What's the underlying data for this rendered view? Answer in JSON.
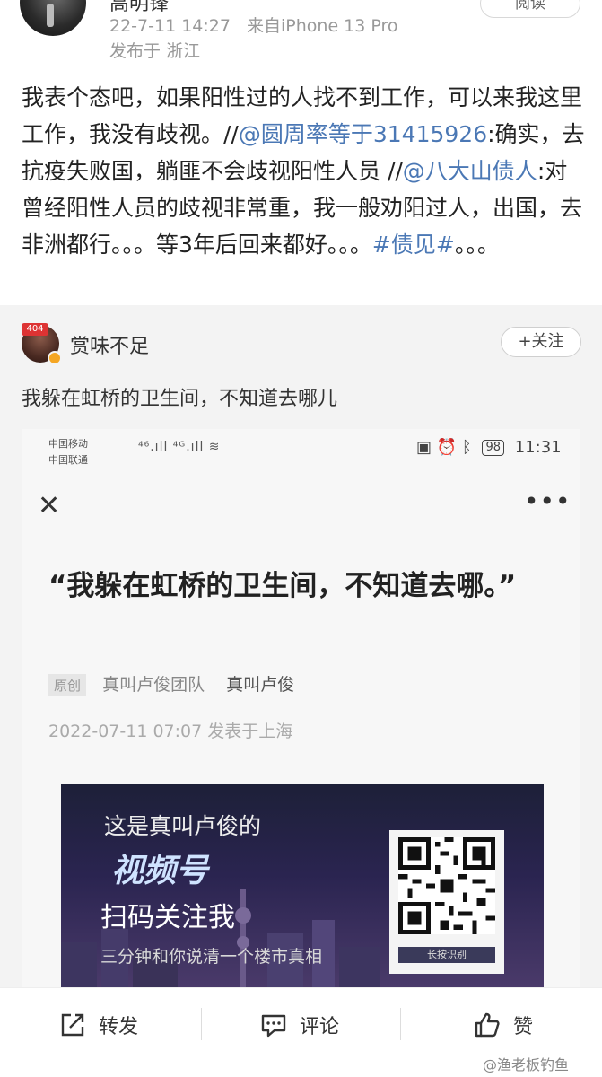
{
  "post": {
    "author_name": "高明锋",
    "timestamp": "22-7-11 14:27",
    "source": "来自iPhone 13 Pro",
    "location": "发布于 浙江",
    "read_button": "阅读",
    "text_part1": "我表个态吧，如果阳性过的人找不到工作，可以来我这里工作，我没有歧视。//",
    "mention1": "@圆周率等于31415926",
    "text_part2": ":确实，去抗疫失败国，躺匪不会歧视阳性人员 //",
    "mention2": "@八大山债人",
    "text_part3": ":对曾经阳性人员的歧视非常重，我一般劝阳过人，出国，去非洲都行。。。等3年后回来都好。。。",
    "hashtag": "#债见#",
    "text_part4": "。。。"
  },
  "original": {
    "avatar_badge": "404",
    "author_name": "赏味不足",
    "follow_button": "+关注",
    "text": "我躲在虹桥的卫生间，不知道去哪儿"
  },
  "screenshot": {
    "status_left1": "中国移动",
    "status_left2": "中国联通",
    "status_signal": "⁴⁶.ıll ⁴ᴳ.ıll ≋",
    "battery": "98",
    "time": "11:31",
    "close_symbol": "✕",
    "more_symbol": "•••",
    "article_title": "“我躲在虹桥的卫生间，不知道去哪。”",
    "tag": "原创",
    "team": "真叫卢俊团队",
    "author": "真叫卢俊",
    "pubdate": "2022-07-11 07:07  发表于上海",
    "banner": {
      "line1": "这是真叫卢俊的",
      "line2": "视频号",
      "line3": "扫码关注我",
      "line4": "三分钟和你说清一个楼市真相",
      "qr_caption": "长按识别"
    }
  },
  "actions": {
    "repost": "转发",
    "comment": "评论",
    "like": "赞"
  },
  "watermark": "@渔老板钓鱼",
  "colors": {
    "link": "#4b78b5",
    "meta_grey": "#999999",
    "embed_bg": "#f3f3f3"
  }
}
